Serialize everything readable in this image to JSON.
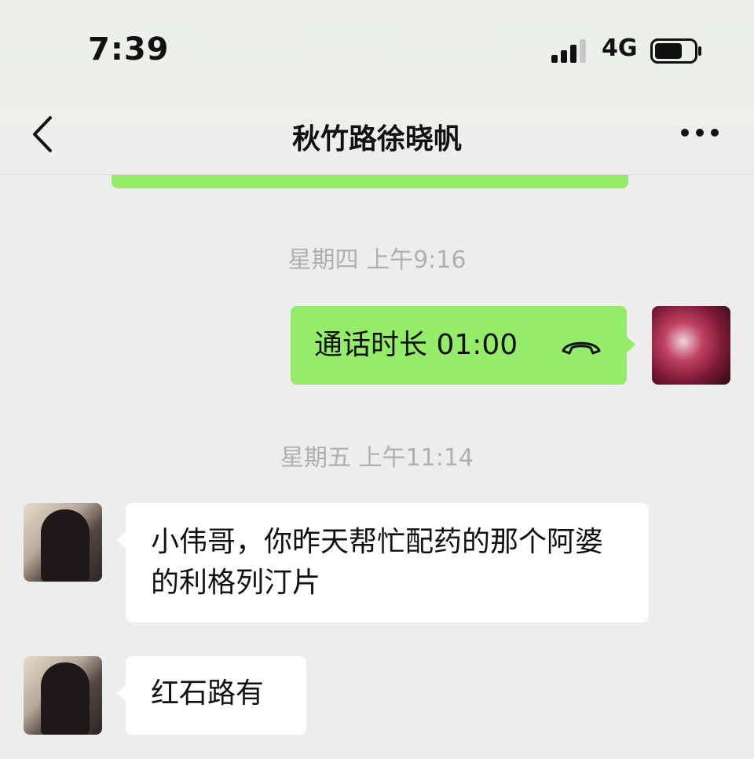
{
  "status_bar": {
    "time": "7:39",
    "network": "4G",
    "icons": [
      "signal-icon",
      "battery-icon"
    ]
  },
  "header": {
    "title": "秋竹路徐晓帆",
    "icons": [
      "back-icon",
      "more-icon"
    ]
  },
  "colors": {
    "outgoing_bubble": "#95ec69",
    "incoming_bubble": "#ffffff",
    "background": "#ededed",
    "timestamp_text": "#b0b0b0"
  },
  "chat": {
    "timestamps": [
      "星期四 上午9:16",
      "星期五 上午11:14"
    ],
    "call_message": {
      "text": "通话时长 01:00",
      "icon": "phone-hangup-icon"
    },
    "messages": [
      {
        "sender": "friend",
        "text": "小伟哥，你昨天帮忙配药的那个阿婆的利格列汀片"
      },
      {
        "sender": "friend",
        "text": "红石路有"
      }
    ]
  }
}
